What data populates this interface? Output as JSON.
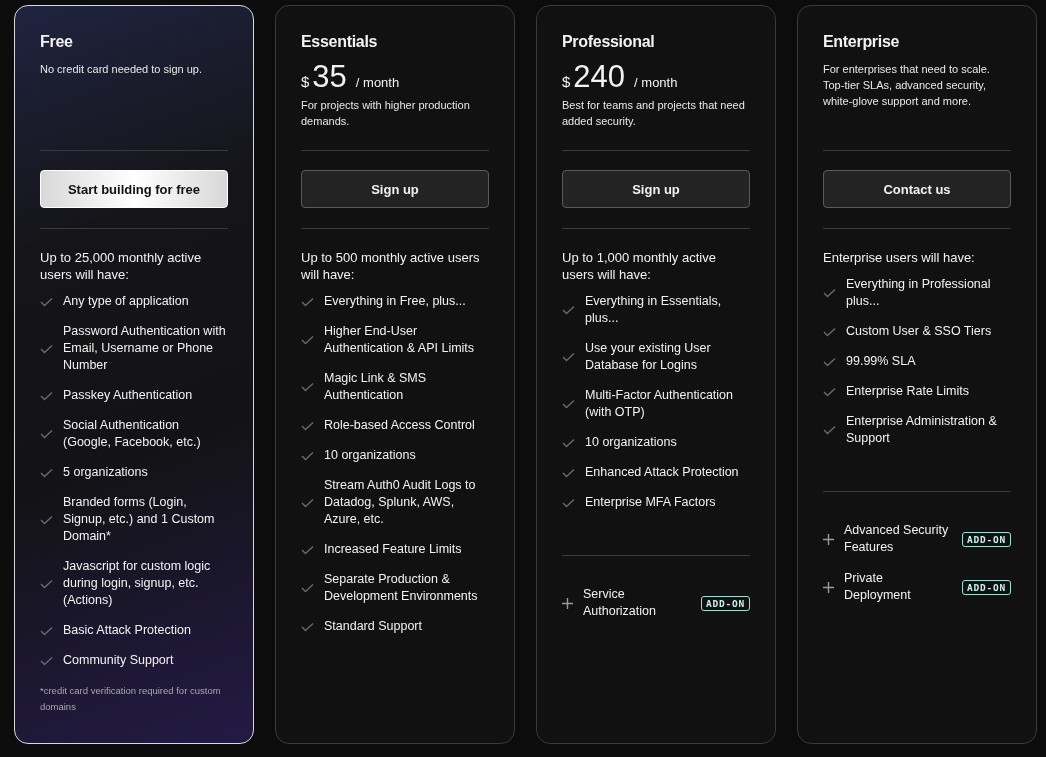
{
  "plans": [
    {
      "name": "Free",
      "highlighted": true,
      "description": "No credit card needed to sign up.",
      "cta": "Start building for free",
      "features_heading": "Up to 25,000 monthly active users will have:",
      "features": [
        "Any type of application",
        "Password Authentication with Email, Username or Phone Number",
        "Passkey Authentication",
        "Social Authentication (Google, Facebook, etc.)",
        "5 organizations",
        "Branded forms (Login, Signup, etc.) and 1 Custom Domain*",
        "Javascript for custom logic during login, signup, etc. (Actions)",
        "Basic Attack Protection",
        "Community Support"
      ],
      "footnote": "*credit card verification required for custom domains"
    },
    {
      "name": "Essentials",
      "highlighted": false,
      "price": {
        "currency": "$",
        "amount": "35",
        "period": "/ month"
      },
      "description": "For projects with higher production demands.",
      "cta": "Sign up",
      "features_heading": "Up to 500 monthly active users will have:",
      "features": [
        "Everything in Free, plus...",
        "Higher End-User Authentication & API Limits",
        "Magic Link & SMS Authentication",
        "Role-based Access Control",
        "10 organizations",
        "Stream Auth0 Audit Logs to Datadog, Splunk, AWS, Azure, etc.",
        "Increased Feature Limits",
        "Separate Production & Development Environments",
        "Standard Support"
      ]
    },
    {
      "name": "Professional",
      "highlighted": false,
      "price": {
        "currency": "$",
        "amount": "240",
        "period": "/ month"
      },
      "description": "Best for teams and projects that need added security.",
      "cta": "Sign up",
      "features_heading": "Up to 1,000 monthly active users will have:",
      "features": [
        "Everything in Essentials, plus...",
        "Use your existing User Database for Logins",
        "Multi-Factor Authentication (with OTP)",
        "10 organizations",
        "Enhanced Attack Protection",
        "Enterprise MFA Factors"
      ],
      "addons": [
        {
          "label": "Service Authorization",
          "badge": "ADD-ON"
        }
      ]
    },
    {
      "name": "Enterprise",
      "highlighted": false,
      "description": "For enterprises that need to scale. Top-tier SLAs, advanced security, white-glove support and more.",
      "cta": "Contact us",
      "features_heading": "Enterprise users will have:",
      "features": [
        "Everything in Professional plus...",
        "Custom User & SSO Tiers",
        "99.99% SLA",
        "Enterprise Rate Limits",
        "Enterprise Administration & Support"
      ],
      "addons": [
        {
          "label": "Advanced Security Features",
          "badge": "ADD-ON"
        },
        {
          "label": "Private Deployment",
          "badge": "ADD-ON"
        }
      ]
    }
  ]
}
